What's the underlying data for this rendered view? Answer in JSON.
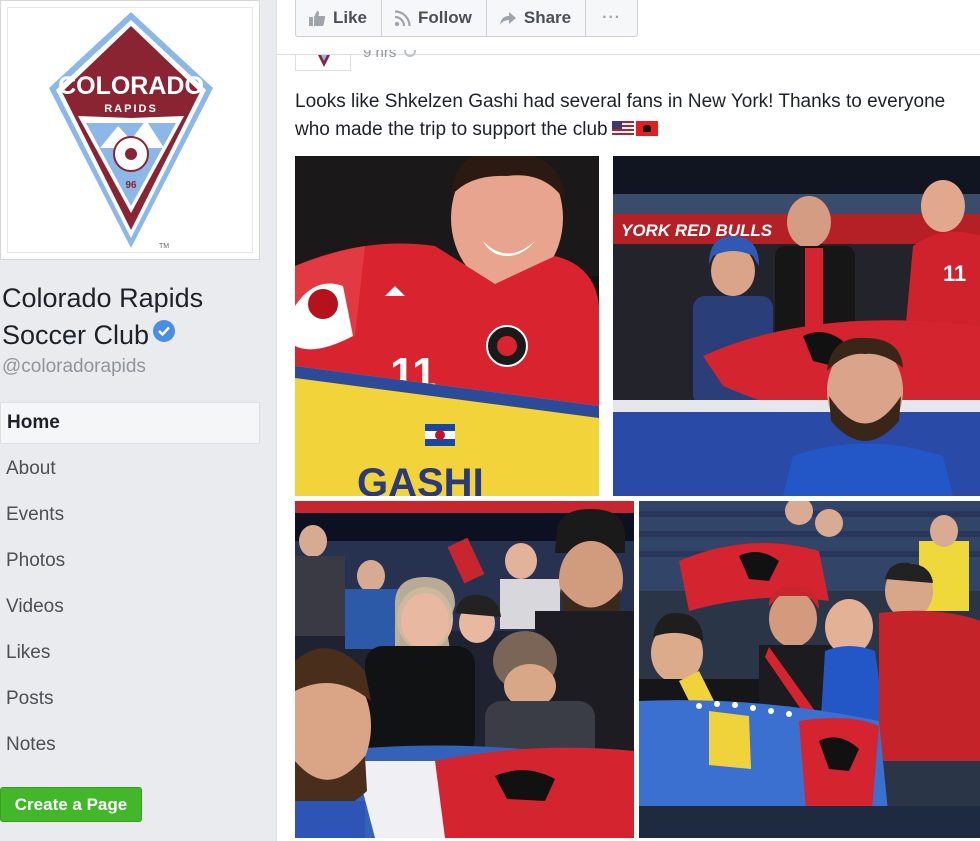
{
  "page": {
    "name": "Colorado Rapids Soccer Club",
    "handle": "@coloradorapids",
    "logo": {
      "text_top": "COLORADO",
      "text_sub": "RAPIDS",
      "year": "96",
      "tm": "TM"
    }
  },
  "nav": {
    "items": [
      "Home",
      "About",
      "Events",
      "Photos",
      "Videos",
      "Likes",
      "Posts",
      "Notes"
    ],
    "active": "Home"
  },
  "create_page_label": "Create a Page",
  "actions": {
    "like": "Like",
    "follow": "Follow",
    "share": "Share",
    "more": "···"
  },
  "post": {
    "time": "9 hrs",
    "text": "Looks like Shkelzen Gashi had several fans in New York! Thanks to everyone who made the trip to support the club",
    "flags": [
      "us-flag",
      "albania-flag"
    ],
    "photos": [
      {
        "jersey_number": "11",
        "jersey_name": "GASHI"
      },
      {
        "banner": "YORK  RED BULLS",
        "jersey_number": "11"
      },
      {},
      {}
    ]
  },
  "colors": {
    "rapids_burgundy": "#8a2432",
    "rapids_blue": "#8bb8e8",
    "fb_green": "#42b72a",
    "fb_verified": "#4a90e2",
    "albania_red": "#e41e20"
  }
}
